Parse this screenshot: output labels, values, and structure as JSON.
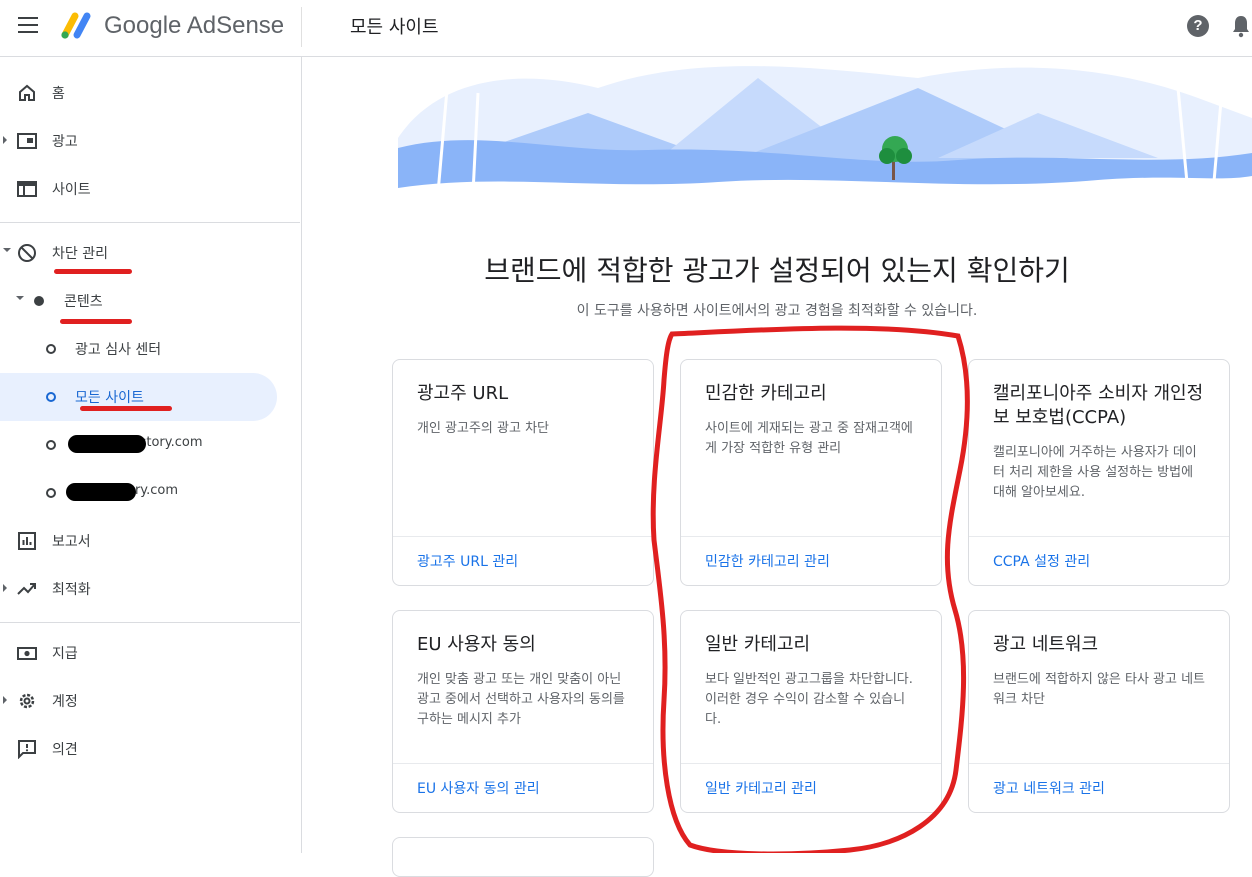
{
  "app": {
    "name": "Google AdSense",
    "page_title": "모든 사이트"
  },
  "header": {
    "help_icon": "help-icon",
    "notifications_icon": "bell-icon"
  },
  "sidebar": {
    "items": [
      {
        "id": "home",
        "label": "홈",
        "icon": "home-icon"
      },
      {
        "id": "ads",
        "label": "광고",
        "icon": "ads-icon"
      },
      {
        "id": "sites",
        "label": "사이트",
        "icon": "sites-icon"
      },
      {
        "id": "blocking",
        "label": "차단 관리",
        "icon": "block-icon"
      },
      {
        "id": "content",
        "label": "콘텐츠"
      },
      {
        "id": "ad-review",
        "label": "광고 심사 센터"
      },
      {
        "id": "all-sites",
        "label": "모든 사이트",
        "selected": true
      },
      {
        "id": "site-1",
        "label": "istory.com"
      },
      {
        "id": "site-2",
        "label": "ory.com"
      },
      {
        "id": "reports",
        "label": "보고서",
        "icon": "reports-icon"
      },
      {
        "id": "optimization",
        "label": "최적화",
        "icon": "trending-icon"
      },
      {
        "id": "payments",
        "label": "지급",
        "icon": "payments-icon"
      },
      {
        "id": "account",
        "label": "계정",
        "icon": "gear-icon"
      },
      {
        "id": "feedback",
        "label": "의견",
        "icon": "feedback-icon"
      }
    ]
  },
  "main": {
    "headline": "브랜드에 적합한 광고가 설정되어 있는지 확인하기",
    "subline": "이 도구를 사용하면 사이트에서의 광고 경험을 최적화할 수 있습니다.",
    "cards": [
      {
        "title": "광고주 URL",
        "description": "개인 광고주의 광고 차단",
        "link": "광고주 URL 관리"
      },
      {
        "title": "민감한 카테고리",
        "description": "사이트에 게재되는 광고 중 잠재고객에게 가장 적합한 유형 관리",
        "link": "민감한 카테고리 관리"
      },
      {
        "title": "캘리포니아주 소비자 개인정보 보호법(CCPA)",
        "description": "캘리포니아에 거주하는 사용자가 데이터 처리 제한을 사용 설정하는 방법에 대해 알아보세요.",
        "link": "CCPA 설정 관리"
      },
      {
        "title": "EU 사용자 동의",
        "description": "개인 맞춤 광고 또는 개인 맞춤이 아닌 광고 중에서 선택하고 사용자의 동의를 구하는 메시지 추가",
        "link": "EU 사용자 동의 관리"
      },
      {
        "title": "일반 카테고리",
        "description": "보다 일반적인 광고그룹을 차단합니다. 이러한 경우 수익이 감소할 수 있습니다.",
        "link": "일반 카테고리 관리"
      },
      {
        "title": "광고 네트워크",
        "description": "브랜드에 적합하지 않은 타사 광고 네트워크 차단",
        "link": "광고 네트워크 관리"
      }
    ]
  },
  "colors": {
    "accent": "#1a73e8",
    "selected_bg": "#e8f0fe",
    "annotation_red": "#e02020"
  }
}
